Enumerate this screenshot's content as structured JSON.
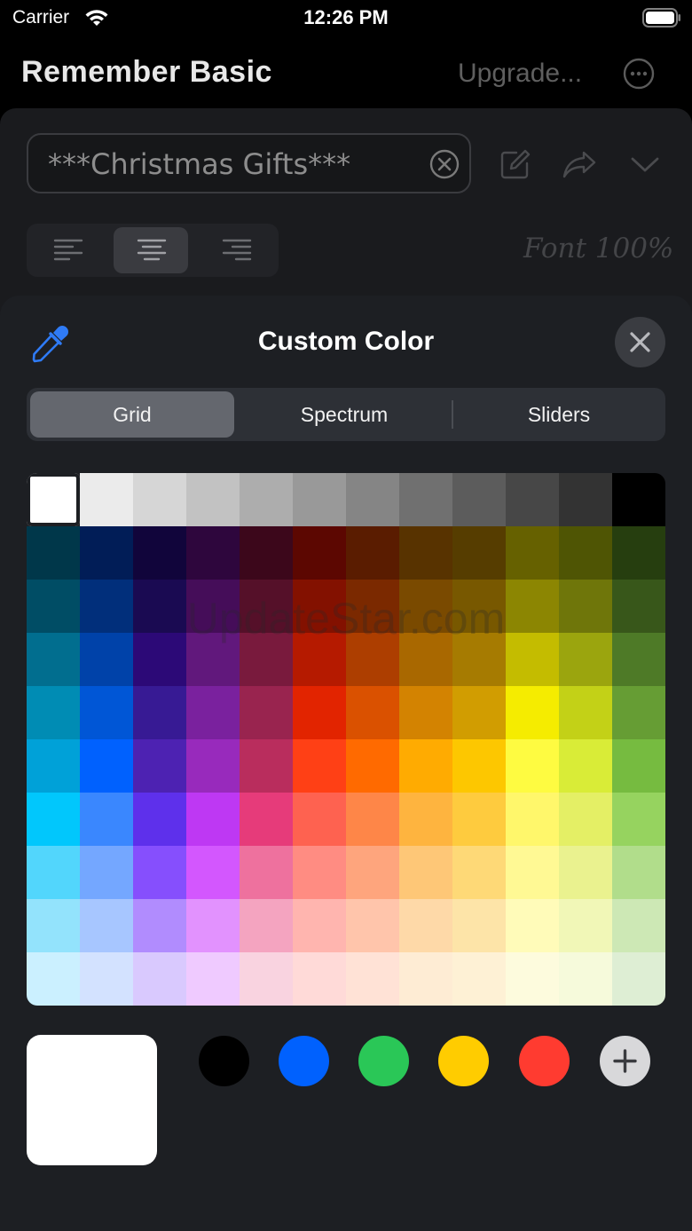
{
  "status_bar": {
    "carrier": "Carrier",
    "time": "12:26 PM"
  },
  "header": {
    "title": "Remember Basic",
    "upgrade_label": "Upgrade..."
  },
  "editor": {
    "list_name": "***Christmas Gifts***",
    "font_size_label": "Font 100%",
    "alignment_selected": "center"
  },
  "color_picker": {
    "title": "Custom Color",
    "tabs": [
      {
        "label": "Grid",
        "selected": true
      },
      {
        "label": "Spectrum",
        "selected": false
      },
      {
        "label": "Sliders",
        "selected": false
      }
    ],
    "grid_colors": [
      [
        "#ffffff",
        "#ebebeb",
        "#d6d6d6",
        "#c2c2c2",
        "#adadad",
        "#999999",
        "#858585",
        "#707070",
        "#5c5c5c",
        "#474747",
        "#333333",
        "#000000"
      ],
      [
        "#00374a",
        "#011d57",
        "#11053b",
        "#2e063d",
        "#3c071b",
        "#5c0701",
        "#5a1c00",
        "#583300",
        "#563d00",
        "#666100",
        "#4f5504",
        "#263e0f"
      ],
      [
        "#004d65",
        "#012f7b",
        "#1a0a52",
        "#450d59",
        "#551029",
        "#831100",
        "#7b2900",
        "#7a4a00",
        "#785800",
        "#8c8602",
        "#6f760a",
        "#38571a"
      ],
      [
        "#016e8f",
        "#0042a9",
        "#2c0977",
        "#61187c",
        "#791a3d",
        "#b51a00",
        "#ad3e00",
        "#a96800",
        "#a67b01",
        "#c4bc00",
        "#9ba50e",
        "#4e7a27"
      ],
      [
        "#008cb4",
        "#0056d6",
        "#371a94",
        "#7a219e",
        "#99244f",
        "#e22400",
        "#da5100",
        "#d38301",
        "#d19d01",
        "#f5ec00",
        "#c3d117",
        "#669d34"
      ],
      [
        "#00a1d8",
        "#0061fe",
        "#4d22b2",
        "#982abc",
        "#b92d5d",
        "#ff4015",
        "#ff6a00",
        "#ffab01",
        "#fdc700",
        "#fefb41",
        "#d9ec37",
        "#76bb40"
      ],
      [
        "#01c7fc",
        "#3a87fe",
        "#5e30eb",
        "#be38f3",
        "#e63b7a",
        "#fe6250",
        "#fe8648",
        "#feb43f",
        "#fecb3e",
        "#fff76b",
        "#e4ef65",
        "#96d35f"
      ],
      [
        "#52d6fc",
        "#74a7ff",
        "#864ffd",
        "#d357fe",
        "#ee719e",
        "#ff8c82",
        "#fea57d",
        "#fec777",
        "#fed977",
        "#fff994",
        "#eaf28f",
        "#b1dd8b"
      ],
      [
        "#93e3fc",
        "#a7c6ff",
        "#b18cfe",
        "#e292fe",
        "#f4a4c0",
        "#ffb5af",
        "#ffc5ab",
        "#fed9a8",
        "#fde4a8",
        "#fffbb9",
        "#f1f7b7",
        "#cde8b5"
      ],
      [
        "#cbf0ff",
        "#d3e2ff",
        "#d9c9fe",
        "#efcaff",
        "#f9d3e0",
        "#ffdad8",
        "#ffe2d6",
        "#feecd4",
        "#fef1d5",
        "#fdfbdd",
        "#f6fadb",
        "#deeed4"
      ]
    ],
    "selected_cell": "#ffffff",
    "current_color": "#ffffff",
    "swatches": [
      {
        "name": "black",
        "color": "#000000"
      },
      {
        "name": "blue",
        "color": "#0061fe"
      },
      {
        "name": "green",
        "color": "#2ac757"
      },
      {
        "name": "yellow",
        "color": "#ffcc00"
      },
      {
        "name": "red",
        "color": "#ff3b30"
      }
    ]
  },
  "watermark": "UpdateStar.com",
  "icons": {
    "status": [
      "wifi-icon",
      "battery-icon"
    ],
    "header": [
      "more-icon"
    ],
    "editor": [
      "clear-icon",
      "edit-icon",
      "share-icon",
      "chevron-down-icon",
      "align-left-icon",
      "align-center-icon",
      "align-right-icon"
    ],
    "picker": [
      "eyedropper-icon",
      "close-icon",
      "plus-icon"
    ]
  }
}
